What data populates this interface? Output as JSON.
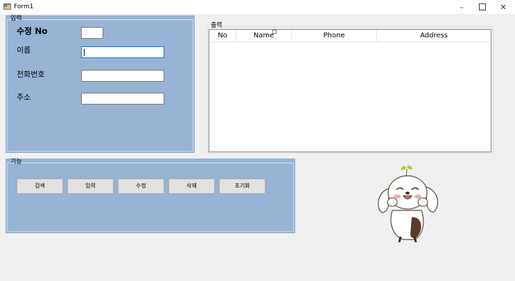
{
  "window": {
    "title": "Form1",
    "minimize": "–",
    "close": "✕"
  },
  "input_group": {
    "title": "입력",
    "labels": {
      "edit_no": "수정 No",
      "name": "이름",
      "phone": "전화번호",
      "address": "주소"
    },
    "values": {
      "edit_no": "",
      "name": "",
      "phone": "",
      "address": ""
    }
  },
  "output_group": {
    "title": "출력",
    "columns": [
      "No",
      "Name",
      "Phone",
      "Address"
    ],
    "rows": []
  },
  "function_group": {
    "title": "기능",
    "buttons": [
      "검색",
      "입력",
      "수정",
      "삭제",
      "초기화"
    ]
  },
  "image": {
    "icon": "cartoon-puppy-mascot"
  }
}
